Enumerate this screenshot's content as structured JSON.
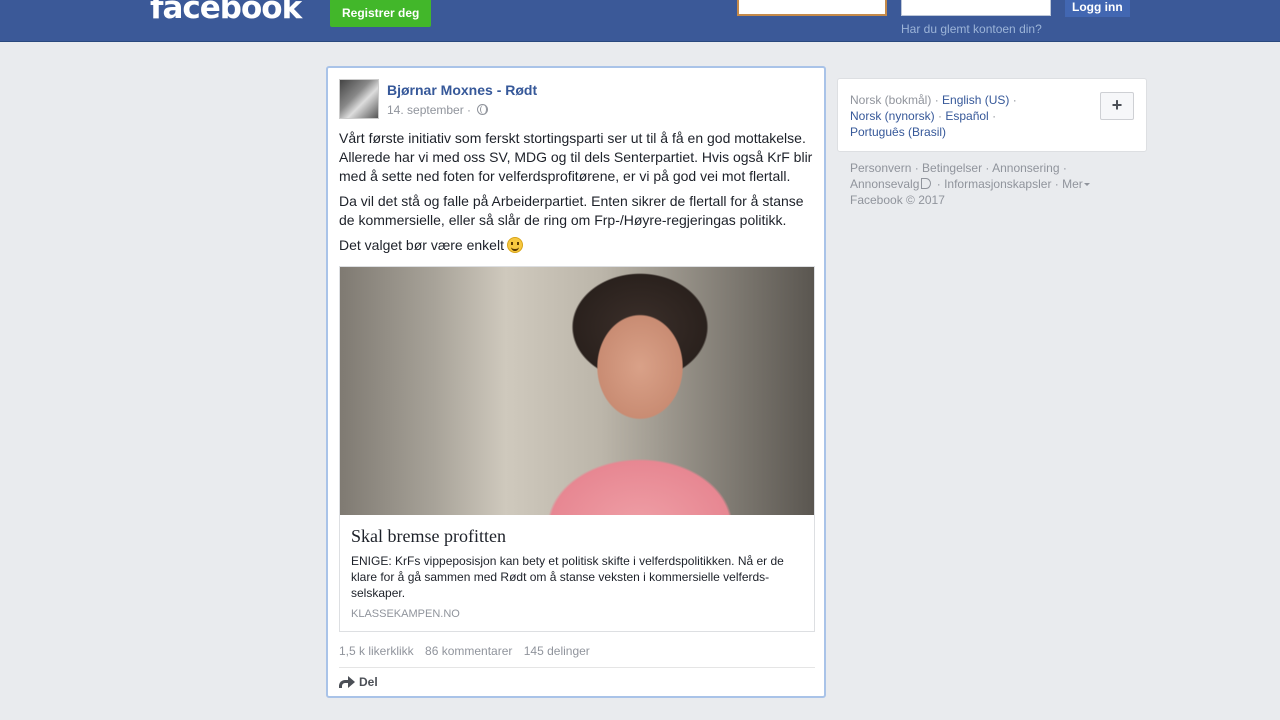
{
  "header": {
    "logo": "facebook",
    "register_label": "Registrer deg",
    "email_value": "",
    "password_value": "",
    "login_label": "Logg inn",
    "forgot_label": "Har du glemt kontoen din?"
  },
  "post": {
    "author": "Bjørnar Moxnes - Rødt",
    "date": "14. september ·",
    "paragraphs": [
      "Vårt første initiativ som ferskt stortingsparti ser ut til å få en god mottakelse. Allerede har vi med oss SV, MDG og til dels Senterpartiet. Hvis også KrF blir med å sette ned foten for velferdsprofitørene, er vi på god vei mot flertall.",
      "Da vil det stå og falle på Arbeiderpartiet. Enten sikrer de flertall for å stanse de kommersielle, eller så slår de ring om Frp-/Høyre-regjeringas politikk.",
      "Det valget bør være enkelt"
    ],
    "link": {
      "title": "Skal bremse profitten",
      "description": "ENIGE: KrFs vippeposisjon kan bety et politisk skifte i velferdspolitikken. Nå er de klare for å gå sammen med Rødt om å stanse veksten i kommersielle velferds­selskaper.",
      "domain": "KLASSEKAMPEN.NO"
    },
    "stats": {
      "likes": "1,5 k likerklikk",
      "comments": "86 kommentarer",
      "shares": "145 delinger"
    },
    "share_label": "Del"
  },
  "languages": {
    "current": "Norsk (bokmål)",
    "items": [
      "English (US)",
      "Norsk (nynorsk)",
      "Español",
      "Português (Brasil)"
    ],
    "add_label": "+"
  },
  "footer": {
    "links": [
      "Personvern",
      "Betingelser",
      "Annonsering",
      "Annonsevalg",
      "Informasjonskapsler",
      "Mer"
    ],
    "copyright": "Facebook © 2017"
  }
}
